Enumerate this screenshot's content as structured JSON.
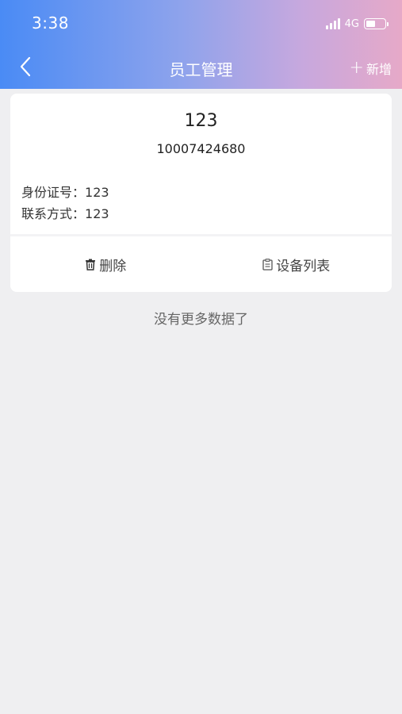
{
  "status": {
    "time": "3:38",
    "network": "4G"
  },
  "nav": {
    "title": "员工管理",
    "add_label": "新增"
  },
  "employee": {
    "name": "123",
    "phone": "10007424680",
    "id_label": "身份证号：",
    "id_value": "123",
    "contact_label": "联系方式：",
    "contact_value": "123",
    "delete_label": "删除",
    "devices_label": "设备列表"
  },
  "list": {
    "end_text": "没有更多数据了"
  },
  "icons": {
    "back": "chevron-left-icon",
    "add": "plus-icon",
    "delete": "trash-icon",
    "devices": "clipboard-icon"
  },
  "colors": {
    "gradient_start": "#4a8bf5",
    "gradient_end": "#e6a9c8",
    "background": "#efeff1"
  }
}
